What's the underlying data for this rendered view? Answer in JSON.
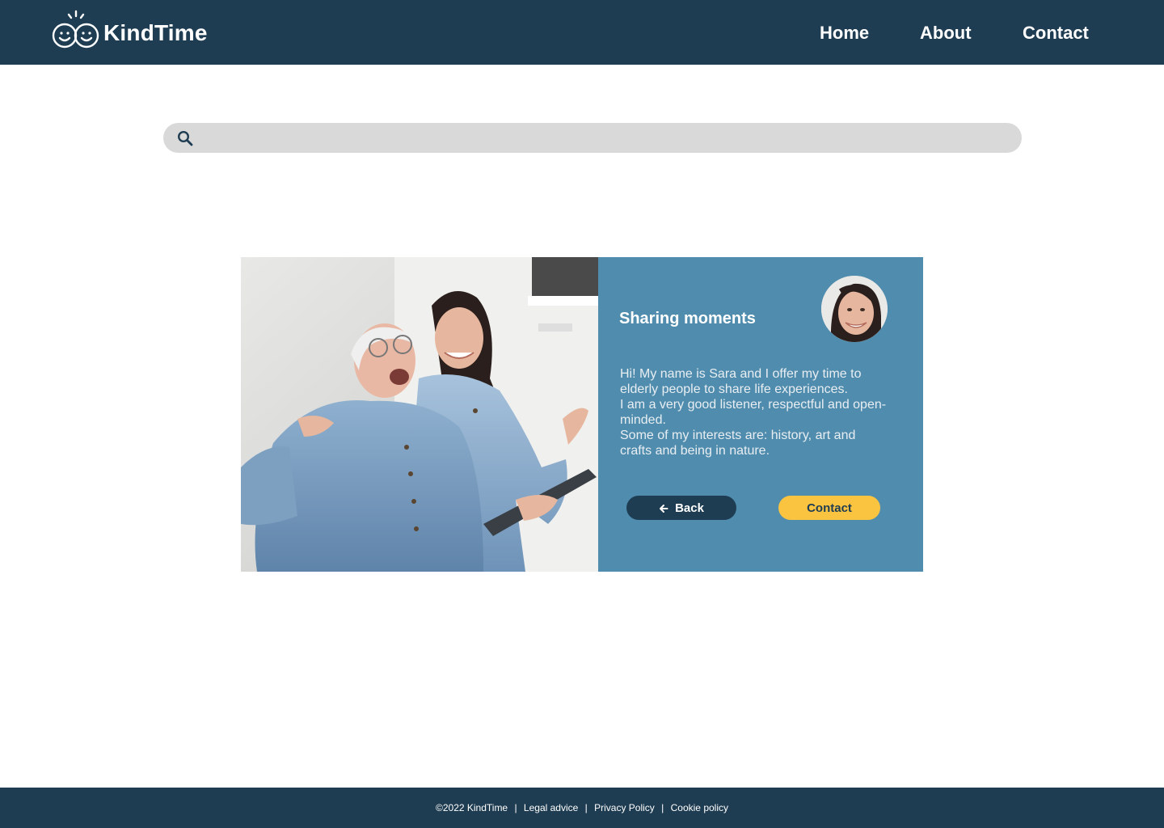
{
  "header": {
    "brand": "KindTime",
    "logo_icon": "two-smiling-faces-icon",
    "nav": [
      "Home",
      "About",
      "Contact"
    ]
  },
  "search": {
    "icon": "search-icon",
    "placeholder": "",
    "value": ""
  },
  "profile": {
    "title": "Sharing moments",
    "bio": [
      "Hi! My name is Sara and I offer my time to elderly people to share life experiences.",
      "I am a very good listener, respectful and open-minded.",
      "Some of my interests are: history, art and crafts and being in nature."
    ],
    "back_label": "Back",
    "back_icon": "arrow-left-icon",
    "contact_label": "Contact"
  },
  "footer": {
    "copyright": "©2022 KindTime",
    "links": [
      "Legal advice",
      "Privacy Policy",
      "Cookie policy"
    ]
  },
  "colors": {
    "navy": "#1f3d52",
    "panel_blue": "#508cad",
    "accent_yellow": "#fbc440",
    "search_bg": "#d9d9d9"
  }
}
